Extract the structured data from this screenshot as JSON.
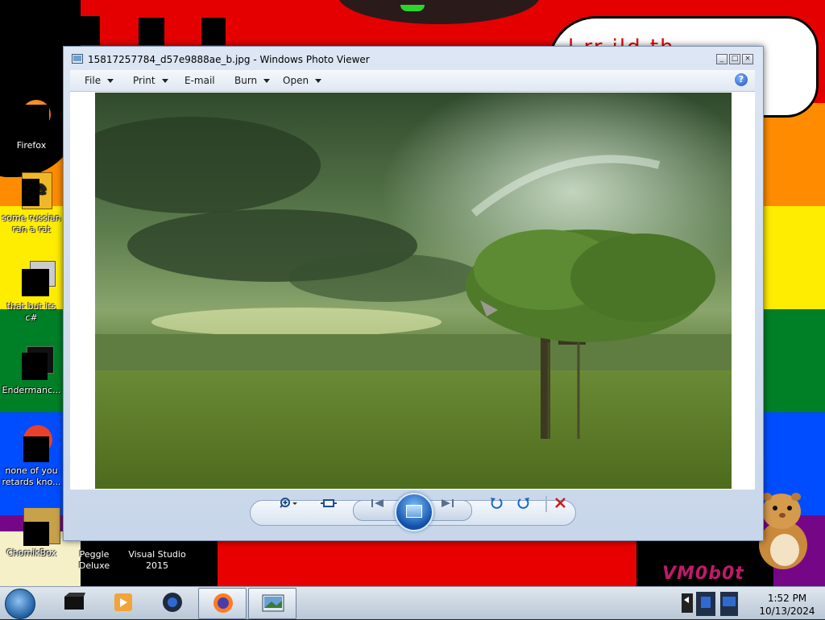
{
  "wallpaper": {
    "speech_text": "l      rr    ild      th",
    "signature": "VM0b0t"
  },
  "desktop_icons": [
    {
      "label": "Firefox"
    },
    {
      "label": "some russian ran a rat"
    },
    {
      "label": "that but its c#"
    },
    {
      "label": "Endermanc..."
    },
    {
      "label": "none of you retards kno..."
    },
    {
      "label": "ChomikBox"
    },
    {
      "label": "Peggle Deluxe"
    },
    {
      "label": "Visual Studio 2015"
    }
  ],
  "window": {
    "title": "15817257784_d57e9888ae_b.jpg - Windows Photo Viewer",
    "menu": {
      "file": "File",
      "print": "Print",
      "email": "E-mail",
      "burn": "Burn",
      "open": "Open",
      "help": "?"
    },
    "controls": {
      "zoom": "zoom-icon",
      "actual_size": "fit-to-window-icon",
      "previous": "previous-icon",
      "slideshow": "slideshow-icon",
      "next": "next-icon",
      "rotate_ccw": "rotate-counterclockwise-icon",
      "rotate_cw": "rotate-clockwise-icon",
      "delete": "delete-icon"
    }
  },
  "taskbar": {
    "clock_time": "1:52 PM",
    "clock_date": "10/13/2024"
  },
  "colors": {
    "rainbow": [
      "#e50000",
      "#ff8c00",
      "#ffed00",
      "#008026",
      "#004dff",
      "#750787"
    ],
    "window_frame": "#dce6f4",
    "delete_red": "#d01818"
  }
}
